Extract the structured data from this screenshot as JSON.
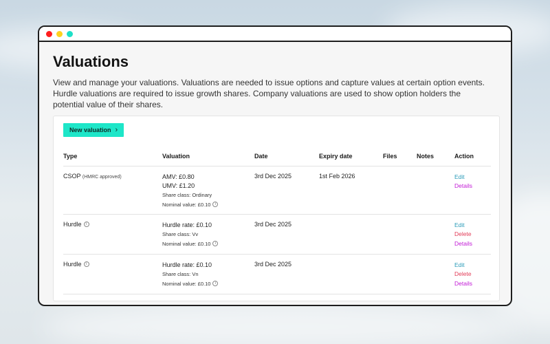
{
  "window": {
    "controls": [
      "close",
      "minimize",
      "maximize"
    ]
  },
  "page": {
    "title": "Valuations",
    "description": "View and manage your valuations. Valuations are needed to issue options and capture values at certain option events. Hurdle valuations are required to issue growth shares. Company valuations are used to show option holders the potential value of their shares."
  },
  "toolbar": {
    "new_valuation_label": "New valuation",
    "chevron": "›"
  },
  "table": {
    "headers": [
      "Type",
      "Valuation",
      "Date",
      "Expiry date",
      "Files",
      "Notes",
      "Action"
    ],
    "rows": [
      {
        "type": "CSOP",
        "type_note": "(HMRC approved)",
        "val_line1": "AMV: £0.80",
        "val_line2": "UMV: £1.20",
        "share_class": "Share class: Ordinary",
        "nominal": "Nominal value: £0.10",
        "date": "3rd Dec 2025",
        "expiry": "1st Feb 2026",
        "actions": {
          "edit": "Edit",
          "details": "Details"
        }
      },
      {
        "type": "Hurdle",
        "val_line1": "Hurdle rate: £0.10",
        "share_class": "Share class: Vv",
        "nominal": "Nominal value: £0.10",
        "date": "3rd Dec 2025",
        "expiry": "",
        "actions": {
          "edit": "Edit",
          "delete": "Delete",
          "details": "Details"
        }
      },
      {
        "type": "Hurdle",
        "val_line1": "Hurdle rate: £0.10",
        "share_class": "Share class: Vn",
        "nominal": "Nominal value: £0.10",
        "date": "3rd Dec 2025",
        "expiry": "",
        "actions": {
          "edit": "Edit",
          "delete": "Delete",
          "details": "Details"
        }
      }
    ]
  },
  "icons": {
    "info": "i"
  },
  "colors": {
    "accent": "#1ee6c8",
    "edit": "#2a9bb8",
    "delete": "#e23b57",
    "details": "#c21bd6"
  }
}
